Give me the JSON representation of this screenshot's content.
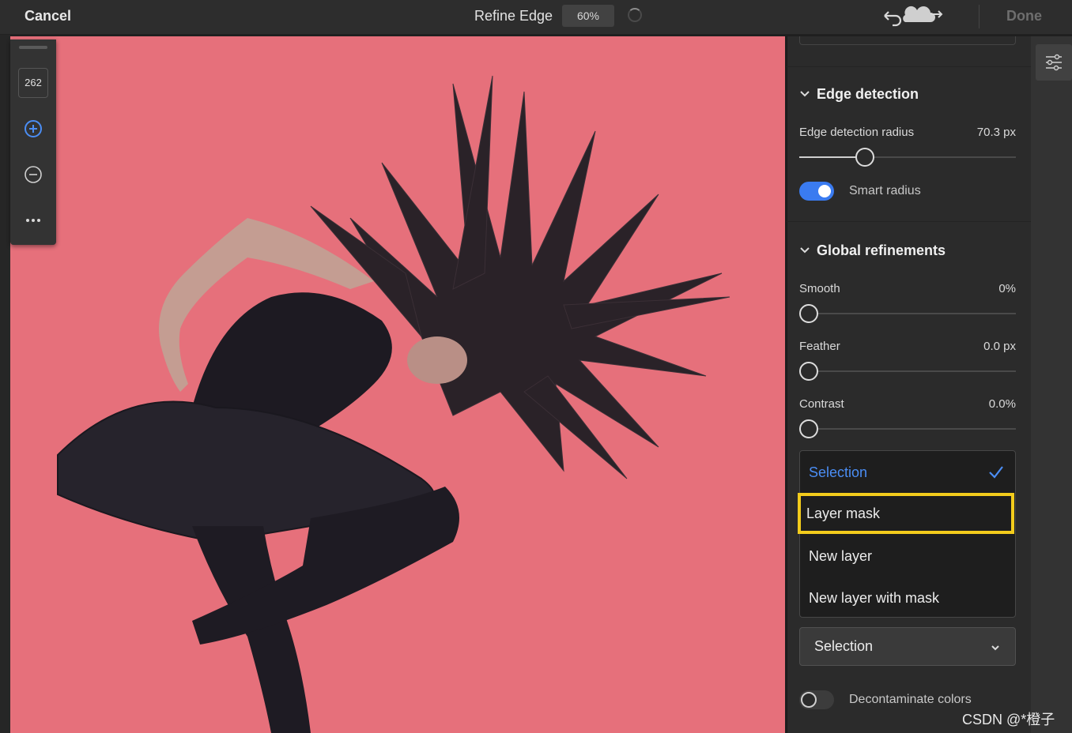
{
  "topbar": {
    "cancel_label": "Cancel",
    "title": "Refine Edge",
    "zoom": "60%",
    "done_label": "Done"
  },
  "toolbar": {
    "brush_size": "262",
    "tools": [
      "add-brush-icon",
      "subtract-brush-icon",
      "more-icon"
    ]
  },
  "edge_detection": {
    "title": "Edge detection",
    "radius_label": "Edge detection radius",
    "radius_value": "70.3 px",
    "radius_fraction": 0.3,
    "smart_radius_label": "Smart radius",
    "smart_radius_on": true
  },
  "global_refinements": {
    "title": "Global refinements",
    "sliders": [
      {
        "label": "Smooth",
        "value": "0%",
        "fraction": 0
      },
      {
        "label": "Feather",
        "value": "0.0 px",
        "fraction": 0
      },
      {
        "label": "Contrast",
        "value": "0.0%",
        "fraction": 0
      }
    ]
  },
  "output_menu": {
    "items": [
      {
        "label": "Selection",
        "selected": true
      },
      {
        "label": "Layer mask",
        "highlighted": true
      },
      {
        "label": "New layer"
      },
      {
        "label": "New layer with mask"
      }
    ]
  },
  "output_dropdown": {
    "value": "Selection"
  },
  "decontaminate": {
    "label": "Decontaminate colors",
    "on": false
  },
  "watermark": "CSDN @*橙子",
  "colors": {
    "accent": "#3a7bf0",
    "highlight": "#f3cc1c",
    "canvas_bg": "#e6707b"
  }
}
